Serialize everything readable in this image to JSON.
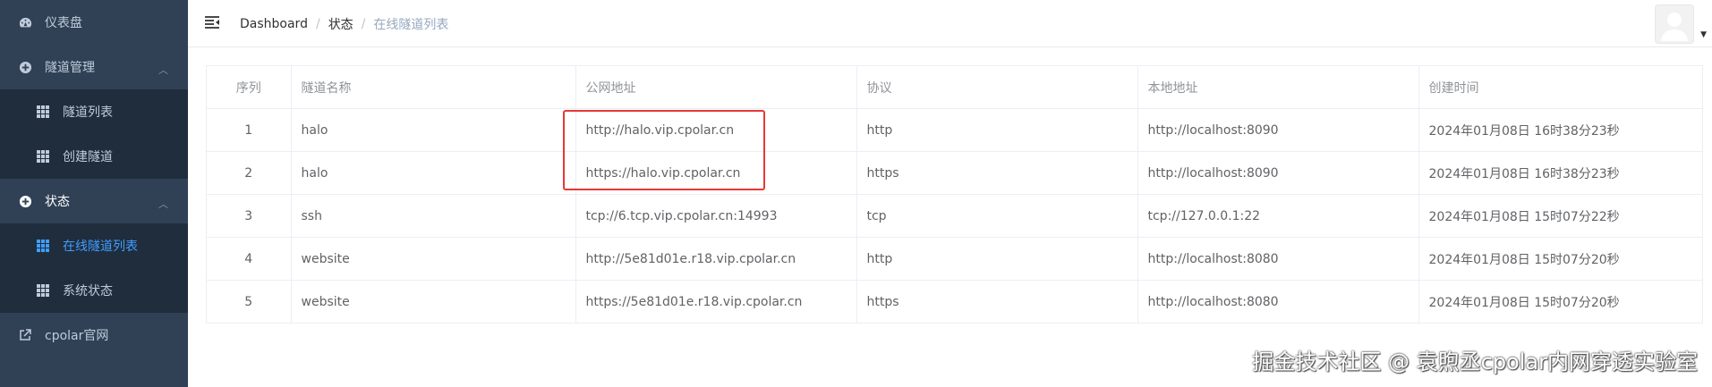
{
  "sidebar": {
    "items": [
      {
        "label": "仪表盘",
        "icon": "dashboard-icon"
      },
      {
        "label": "隧道管理",
        "icon": "circle-plus-icon"
      },
      {
        "label": "隧道列表",
        "icon": "grid-icon"
      },
      {
        "label": "创建隧道",
        "icon": "grid-icon"
      },
      {
        "label": "状态",
        "icon": "circle-plus-icon"
      },
      {
        "label": "在线隧道列表",
        "icon": "grid-icon"
      },
      {
        "label": "系统状态",
        "icon": "grid-icon"
      },
      {
        "label": "cpolar官网",
        "icon": "external-link-icon"
      }
    ]
  },
  "breadcrumb": [
    "Dashboard",
    "状态",
    "在线隧道列表"
  ],
  "table": {
    "columns": [
      "序列",
      "隧道名称",
      "公网地址",
      "协议",
      "本地地址",
      "创建时间"
    ],
    "rows": [
      [
        "1",
        "halo",
        "http://halo.vip.cpolar.cn",
        "http",
        "http://localhost:8090",
        "2024年01月08日 16时38分23秒"
      ],
      [
        "2",
        "halo",
        "https://halo.vip.cpolar.cn",
        "https",
        "http://localhost:8090",
        "2024年01月08日 16时38分23秒"
      ],
      [
        "3",
        "ssh",
        "tcp://6.tcp.vip.cpolar.cn:14993",
        "tcp",
        "tcp://127.0.0.1:22",
        "2024年01月08日 15时07分22秒"
      ],
      [
        "4",
        "website",
        "http://5e81d01e.r18.vip.cpolar.cn",
        "http",
        "http://localhost:8080",
        "2024年01月08日 15时07分20秒"
      ],
      [
        "5",
        "website",
        "https://5e81d01e.r18.vip.cpolar.cn",
        "https",
        "http://localhost:8080",
        "2024年01月08日 15时07分20秒"
      ]
    ]
  },
  "watermark": "掘金技术社区 @ 袁煦丞cpolar内网穿透实验室",
  "colors": {
    "sidebar_bg": "#304156",
    "submenu_bg": "#1f2d3d",
    "active": "#409eff",
    "highlight": "#e53935"
  }
}
